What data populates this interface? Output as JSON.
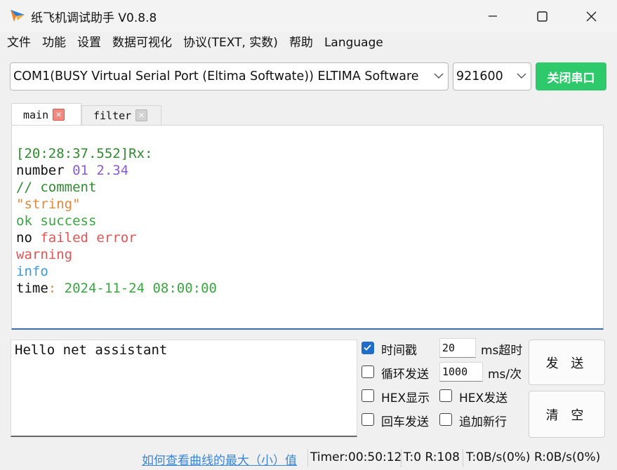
{
  "window": {
    "title": "纸飞机调试助手 V0.8.8",
    "buttons": {
      "minimize": "—",
      "maximize": "☐",
      "close": "✕"
    }
  },
  "menu": [
    "文件",
    "功能",
    "设置",
    "数据可视化",
    "协议(TEXT, 实数)",
    "帮助",
    "Language"
  ],
  "serial": {
    "port": "COM1(BUSY  Virtual Serial Port (Eltima Softwate)) ELTIMA Software",
    "baud": "921600",
    "close_button": "关闭串口",
    "accent": "#2ec96a"
  },
  "tabs": [
    {
      "label": "main",
      "active": true
    },
    {
      "label": "filter",
      "active": false
    }
  ],
  "terminal_lines": [
    [
      {
        "text": "[20:28:37.552]Rx:",
        "color": "#2e8b2e"
      }
    ],
    [
      {
        "text": "number ",
        "color": "#111111"
      },
      {
        "text": "01 2.34",
        "color": "#8a5cd6"
      }
    ],
    [
      {
        "text": "// comment",
        "color": "#2e8b2e"
      }
    ],
    [
      {
        "text": "\"string\"",
        "color": "#e0883a"
      }
    ],
    [
      {
        "text": "ok success",
        "color": "#3aa640"
      }
    ],
    [
      {
        "text": "no ",
        "color": "#111111"
      },
      {
        "text": "failed error",
        "color": "#e05555"
      }
    ],
    [
      {
        "text": "warning",
        "color": "#e05555"
      }
    ],
    [
      {
        "text": "info",
        "color": "#3b9ad9"
      }
    ],
    [
      {
        "text": "time",
        "color": "#111111"
      },
      {
        "text": ": ",
        "color": "#e0883a"
      },
      {
        "text": "2024-11-24 08:00:00",
        "color": "#3aa640"
      }
    ]
  ],
  "send": {
    "input_value": "Hello net assistant",
    "timestamp": {
      "label": "时间戳",
      "checked": true,
      "value": "20",
      "unit": "ms超时"
    },
    "loop_send": {
      "label": "循环发送",
      "checked": false,
      "value": "1000",
      "unit": "ms/次"
    },
    "hex_display": {
      "label": "HEX显示",
      "checked": false
    },
    "hex_send": {
      "label": "HEX发送",
      "checked": false
    },
    "enter_send": {
      "label": "回车发送",
      "checked": false
    },
    "append_newline": {
      "label": "追加新行",
      "checked": false
    },
    "send_button": "发 送",
    "clear_button": "清 空"
  },
  "status": {
    "help_link": "如何查看曲线的最大（小）值",
    "timer": "Timer:00:50:12",
    "counts": "T:0 R:108",
    "rates": "T:0B/s(0%) R:0B/s(0%)"
  }
}
